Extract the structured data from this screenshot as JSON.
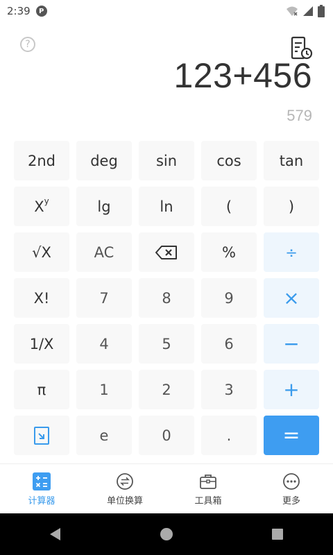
{
  "status_bar": {
    "time": "2:39"
  },
  "display": {
    "expression": "123+456",
    "result": "579"
  },
  "keypad": {
    "row1": [
      "2nd",
      "deg",
      "sin",
      "cos",
      "tan"
    ],
    "row2": [
      "X",
      "lg",
      "ln",
      "(",
      ")"
    ],
    "row2_sup": "y",
    "row3": [
      "√X",
      "AC",
      "⌫",
      "%",
      "÷"
    ],
    "row4": [
      "X!",
      "7",
      "8",
      "9",
      "×"
    ],
    "row5": [
      "1/X",
      "4",
      "5",
      "6",
      "−"
    ],
    "row6": [
      "π",
      "1",
      "2",
      "3",
      "+"
    ],
    "row7": [
      "",
      "e",
      "0",
      ".",
      "="
    ]
  },
  "bottom_nav": [
    {
      "label": "计算器",
      "icon": "calculator-icon",
      "active": true
    },
    {
      "label": "单位换算",
      "icon": "unit-convert-icon",
      "active": false
    },
    {
      "label": "工具箱",
      "icon": "toolbox-icon",
      "active": false
    },
    {
      "label": "更多",
      "icon": "more-icon",
      "active": false
    }
  ],
  "colors": {
    "accent": "#3e9df1",
    "op_bg": "#eef6fd",
    "key_bg": "#f8f8f8"
  }
}
